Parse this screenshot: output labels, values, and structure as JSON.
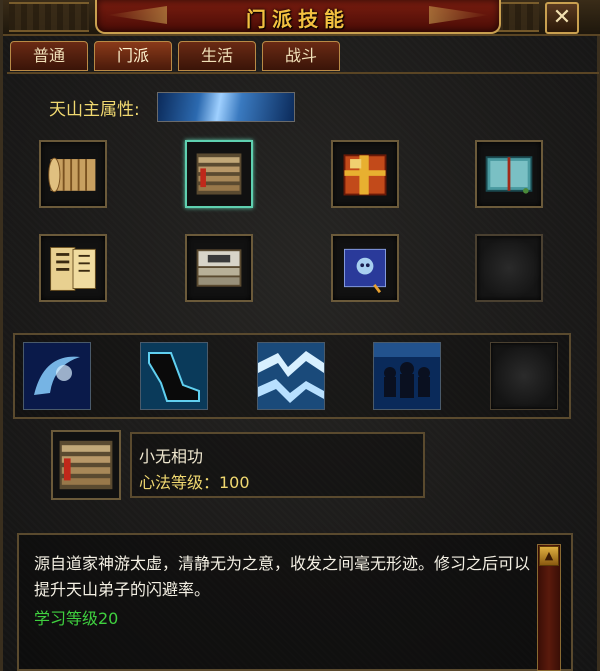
{
  "window": {
    "title": "门派技能",
    "close_label": "✕"
  },
  "tabs": [
    {
      "label": "普通",
      "active": false
    },
    {
      "label": "门派",
      "active": true
    },
    {
      "label": "生活",
      "active": false
    },
    {
      "label": "战斗",
      "active": false
    }
  ],
  "attribute": {
    "label": "天山主属性:"
  },
  "book_slots": [
    {
      "icon": "bamboo-scroll-icon",
      "selected": false
    },
    {
      "icon": "red-tomb-book-icon",
      "selected": true
    },
    {
      "icon": "red-tied-book-icon",
      "selected": false
    },
    {
      "icon": "blue-book-icon",
      "selected": false
    },
    {
      "icon": "yellow-scroll-book-icon",
      "selected": false
    },
    {
      "icon": "grey-tomb-book-icon",
      "selected": false
    },
    {
      "icon": "blue-skull-scroll-icon",
      "selected": false
    },
    {
      "icon": "empty-slot-icon",
      "selected": false
    }
  ],
  "skill_slots": [
    {
      "icon": "ice-swirl-skill-icon"
    },
    {
      "icon": "kick-skill-icon"
    },
    {
      "icon": "ice-wave-skill-icon"
    },
    {
      "icon": "shadow-figures-skill-icon"
    },
    {
      "icon": "empty-slot-icon"
    }
  ],
  "selected_skill": {
    "icon": "red-tomb-book-icon",
    "name": "小无相功",
    "level_text": "心法等级：100"
  },
  "description": {
    "text": "源自道家神游太虚，清静无为之意，收发之间毫无形迹。修习之后可以提升天山弟子的闪避率。",
    "requirement": "学习等级20"
  },
  "colors": {
    "title": "#f2c040",
    "tab_bg": "#6a2a14",
    "selected_border": "#5fd0b0",
    "requirement_text": "#3fd03f"
  }
}
